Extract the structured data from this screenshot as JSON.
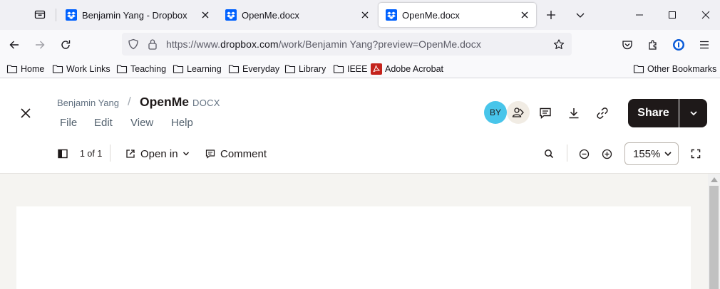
{
  "browser": {
    "tabs": [
      {
        "title": "Benjamin Yang - Dropbox",
        "active": false
      },
      {
        "title": "OpenMe.docx",
        "active": false
      },
      {
        "title": "OpenMe.docx",
        "active": true
      }
    ],
    "address": {
      "prefix": "https://www.",
      "host": "dropbox.com",
      "path": "/work/Benjamin Yang?preview=OpenMe.docx"
    },
    "bookmarks": [
      {
        "label": "Home",
        "icon": "folder-icon"
      },
      {
        "label": "Work Links",
        "icon": "folder-icon"
      },
      {
        "label": "Teaching",
        "icon": "folder-icon"
      },
      {
        "label": "Learning",
        "icon": "folder-icon"
      },
      {
        "label": "Everyday",
        "icon": "folder-icon"
      },
      {
        "label": "Library",
        "icon": "folder-icon"
      },
      {
        "label": "IEEE",
        "icon": "folder-icon"
      },
      {
        "label": "Adobe Acrobat",
        "icon": "acrobat-icon"
      }
    ],
    "other_bookmarks": "Other Bookmarks",
    "colors": {
      "dropbox_blue": "#0061fe",
      "acrobat_red": "#c4231c"
    }
  },
  "app": {
    "owner": "Benjamin Yang",
    "slash": "/",
    "doc_name": "OpenMe",
    "doc_ext": "DOCX",
    "menu": [
      "File",
      "Edit",
      "View",
      "Help"
    ],
    "avatar_initials": "BY",
    "avatar_color": "#48c5ea",
    "share_label": "Share"
  },
  "viewer": {
    "page_count": "1 of 1",
    "open_in": "Open in",
    "comment": "Comment",
    "zoom": "155%"
  }
}
